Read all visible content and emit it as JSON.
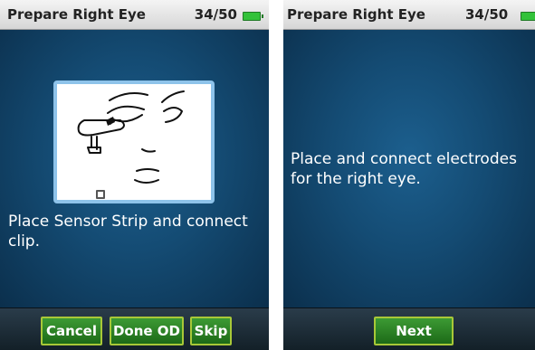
{
  "screens": [
    {
      "title": "Prepare Right Eye",
      "counter": "34/50",
      "message": "Place Sensor Strip and connect clip.",
      "buttons": {
        "cancel": "Cancel",
        "done_od": "Done OD",
        "skip": "Skip"
      }
    },
    {
      "title": "Prepare Right Eye",
      "counter": "34/50",
      "message": "Place and connect electrodes for the right eye.",
      "buttons": {
        "next": "Next"
      }
    }
  ],
  "colors": {
    "title_bar": "#e6e6e6",
    "content_bg": "#144b73",
    "button_fill": "#2e8a28",
    "button_border": "#a8c838",
    "battery": "#33c23a"
  },
  "icons": [
    "battery-icon",
    "face-sensor-illustration"
  ]
}
